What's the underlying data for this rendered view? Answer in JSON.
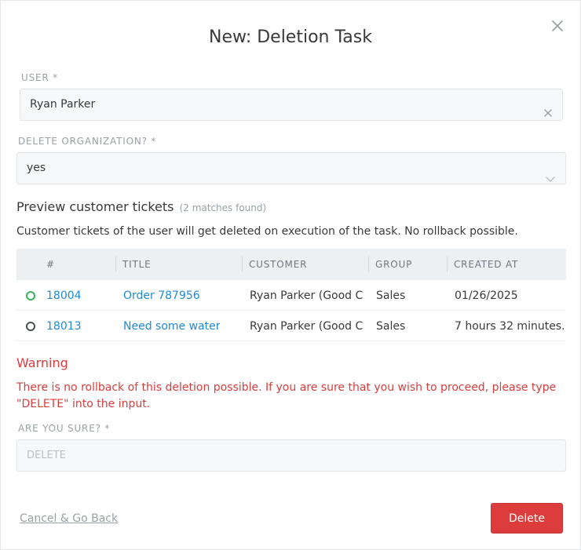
{
  "modal": {
    "title": "New: Deletion Task"
  },
  "user_field": {
    "label": "USER *",
    "value": "Ryan Parker"
  },
  "org_field": {
    "label": "DELETE ORGANIZATION? *",
    "value": "yes"
  },
  "preview": {
    "title": "Preview customer tickets",
    "count": "(2 matches found)",
    "description": "Customer tickets of the user will get deleted on execution of the task. No rollback possible."
  },
  "table": {
    "columns": [
      "#",
      "TITLE",
      "CUSTOMER",
      "GROUP",
      "CREATED AT"
    ],
    "rows": [
      {
        "status": "open",
        "status_color": "#38b35c",
        "number": "18004",
        "title": "Order 787956",
        "customer": "Ryan Parker (Good C...",
        "group": "Sales",
        "created": "01/26/2025"
      },
      {
        "status": "closed",
        "status_color": "#4a4f54",
        "number": "18013",
        "title": "Need some water",
        "customer": "Ryan Parker (Good C...",
        "group": "Sales",
        "created": "7 hours 32 minutes..."
      }
    ]
  },
  "warning": {
    "title": "Warning",
    "text": "There is no rollback of this deletion possible. If you are sure that you wish to proceed, please type \"DELETE\" into the input."
  },
  "confirm": {
    "label": "ARE YOU SURE? *",
    "placeholder": "DELETE",
    "value": ""
  },
  "actions": {
    "cancel_label": "Cancel & Go Back",
    "delete_label": "Delete"
  },
  "colors": {
    "danger": "#dc3c3c",
    "link": "#1f8ad6",
    "open_status": "#38b35c"
  }
}
